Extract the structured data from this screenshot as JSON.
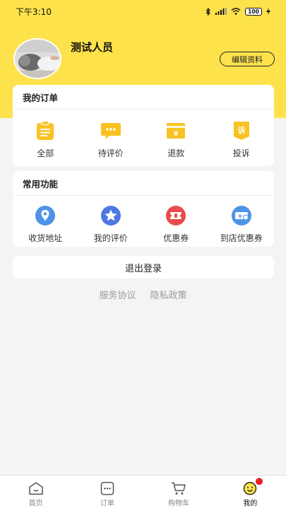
{
  "status_bar": {
    "time": "下午3:10",
    "battery": "100"
  },
  "profile": {
    "name": "测试人员",
    "edit_label": "编辑资料"
  },
  "orders": {
    "title": "我的订单",
    "items": [
      {
        "label": "全部",
        "icon": "clipboard-icon"
      },
      {
        "label": "待评价",
        "icon": "chat-dots-icon"
      },
      {
        "label": "退款",
        "icon": "refund-yen-icon"
      },
      {
        "label": "投诉",
        "icon": "complaint-icon"
      }
    ]
  },
  "functions": {
    "title": "常用功能",
    "items": [
      {
        "label": "收货地址",
        "icon": "location-pin-icon"
      },
      {
        "label": "我的评价",
        "icon": "star-icon"
      },
      {
        "label": "优惠券",
        "icon": "coupon-icon"
      },
      {
        "label": "到店优惠券",
        "icon": "store-coupon-icon"
      }
    ]
  },
  "logout_label": "退出登录",
  "links": {
    "service": "服务协议",
    "privacy": "隐私政策"
  },
  "tabbar": {
    "items": [
      {
        "label": "首页",
        "icon": "home-icon"
      },
      {
        "label": "订单",
        "icon": "order-icon"
      },
      {
        "label": "购物车",
        "icon": "cart-icon"
      },
      {
        "label": "我的",
        "icon": "smiley-icon"
      }
    ],
    "active": "我的"
  },
  "colors": {
    "brand_yellow": "#fee24b",
    "icon_yellow": "#f8c322",
    "icon_blue": "#4f93e6",
    "icon_red": "#ea4b4b",
    "badge_red": "#e8231f"
  }
}
